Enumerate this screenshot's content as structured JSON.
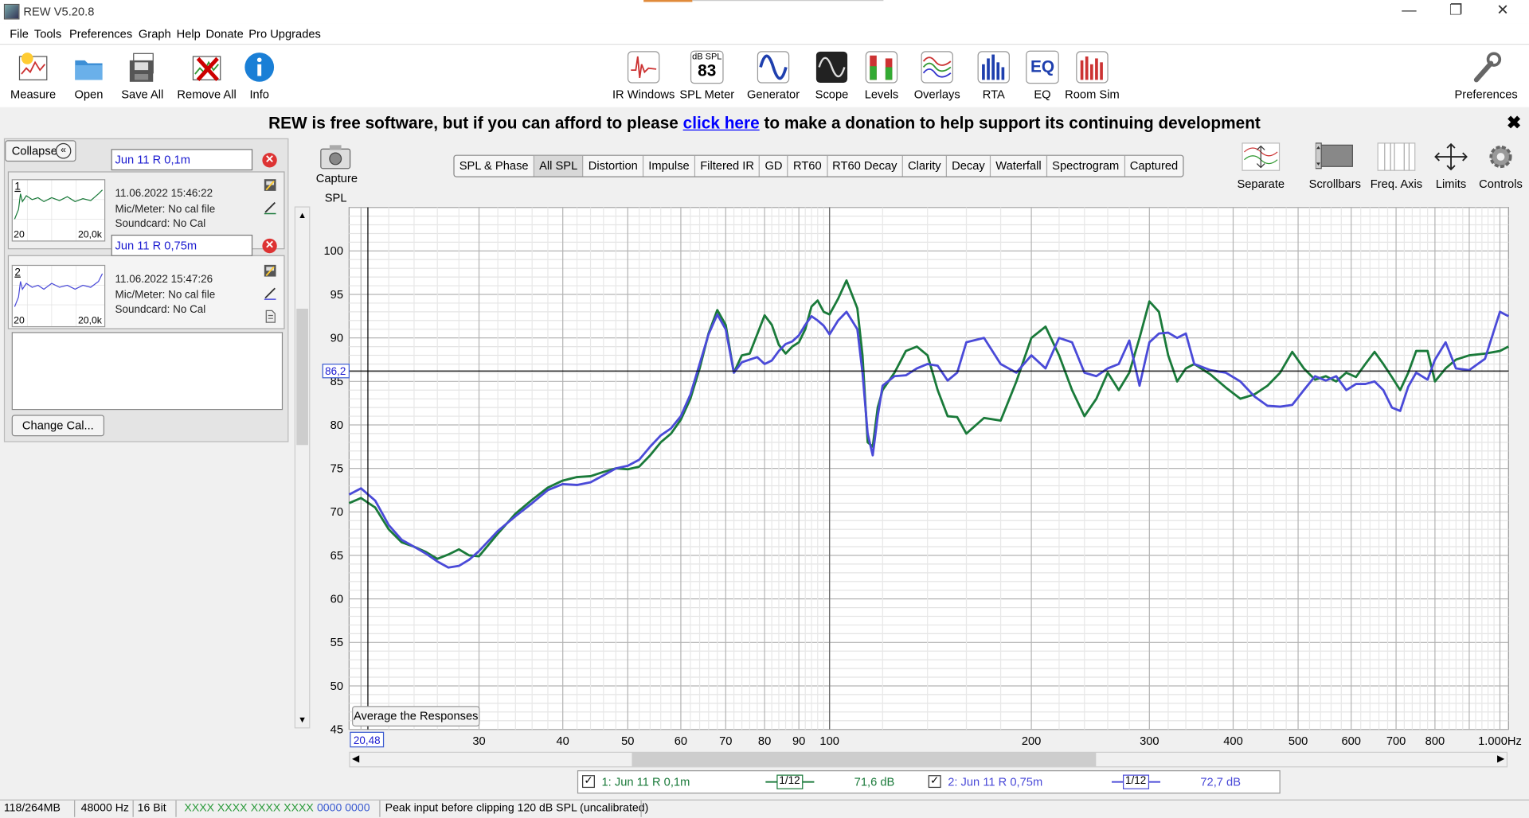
{
  "window": {
    "title": "REW V5.20.8",
    "minimize": "—",
    "restore": "❐",
    "close": "✕"
  },
  "menu": [
    "File",
    "Tools",
    "Preferences",
    "Graph",
    "Help",
    "Donate",
    "Pro Upgrades"
  ],
  "toolbar_left": [
    "Measure",
    "Open",
    "Save All",
    "Remove All",
    "Info"
  ],
  "toolbar_mid": [
    "IR Windows",
    "SPL Meter",
    "Generator",
    "Scope",
    "Levels",
    "Overlays",
    "RTA",
    "EQ",
    "Room Sim"
  ],
  "spl_meter_icon": {
    "top": "dB SPL",
    "value": "83"
  },
  "toolbar_right": "Preferences",
  "banner": {
    "pre": "REW is free software, but if you can afford to please ",
    "link": "click here",
    "post": " to make a donation to help support its continuing development",
    "close": "✖"
  },
  "panel": {
    "collapse": "Collapse",
    "measurements": [
      {
        "index": "1",
        "name": "Jun 11 R 0,1m",
        "date": "11.06.2022 15:46:22",
        "mic": "Mic/Meter: No cal file",
        "soundcard": "Soundcard: No Cal",
        "thumb_min": "20",
        "thumb_max": "20,0k",
        "color": "#1a7a3a"
      },
      {
        "index": "2",
        "name": "Jun 11 R 0,75m",
        "date": "11.06.2022 15:47:26",
        "mic": "Mic/Meter: No cal file",
        "soundcard": "Soundcard: No Cal",
        "thumb_min": "20",
        "thumb_max": "20,0k",
        "color": "#4a4ad8"
      }
    ],
    "change_cal": "Change Cal..."
  },
  "capture": "Capture",
  "tabs": [
    {
      "label": "SPL & Phase",
      "active": false
    },
    {
      "label": "All SPL",
      "active": true
    },
    {
      "label": "Distortion",
      "active": false
    },
    {
      "label": "Impulse",
      "active": false
    },
    {
      "label": "Filtered IR",
      "active": false
    },
    {
      "label": "GD",
      "active": false
    },
    {
      "label": "RT60",
      "active": false
    },
    {
      "label": "RT60 Decay",
      "active": false
    },
    {
      "label": "Clarity",
      "active": false
    },
    {
      "label": "Decay",
      "active": false
    },
    {
      "label": "Waterfall",
      "active": false
    },
    {
      "label": "Spectrogram",
      "active": false
    },
    {
      "label": "Captured",
      "active": false
    }
  ],
  "right_tools": [
    "Separate",
    "Scrollbars",
    "Freq. Axis",
    "Limits",
    "Controls"
  ],
  "average_btn": "Average the Responses",
  "legend": [
    {
      "label": "1: Jun 11 R 0,1m",
      "smoothing": "1/12",
      "level": "71,6 dB",
      "color": "#1a7a3a"
    },
    {
      "label": "2: Jun 11 R 0,75m",
      "smoothing": "1/12",
      "level": "72,7 dB",
      "color": "#4a4ad8"
    }
  ],
  "status": {
    "memory": "118/264MB",
    "rate": "48000 Hz",
    "bits": "16 Bit",
    "g1": "XXXX XXXX",
    "g2": "XXXX XXXX",
    "b1": "0000 0000",
    "peak": "Peak input before clipping 120 dB SPL (uncalibrated)"
  },
  "chart_data": {
    "type": "line",
    "ylabel": "SPL",
    "xunit": "Hz",
    "xscale": "log",
    "xlim": [
      19.2,
      1030
    ],
    "ylim": [
      45,
      105
    ],
    "yticks": [
      45,
      50,
      55,
      60,
      65,
      70,
      75,
      80,
      85,
      90,
      95,
      100
    ],
    "xticks": [
      {
        "value": 30,
        "label": "30"
      },
      {
        "value": 40,
        "label": "40"
      },
      {
        "value": 50,
        "label": "50"
      },
      {
        "value": 60,
        "label": "60"
      },
      {
        "value": 70,
        "label": "70"
      },
      {
        "value": 80,
        "label": "80"
      },
      {
        "value": 90,
        "label": "90"
      },
      {
        "value": 100,
        "label": "100"
      },
      {
        "value": 200,
        "label": "200"
      },
      {
        "value": 300,
        "label": "300"
      },
      {
        "value": 400,
        "label": "400"
      },
      {
        "value": 500,
        "label": "500"
      },
      {
        "value": 600,
        "label": "600"
      },
      {
        "value": 700,
        "label": "700"
      },
      {
        "value": 800,
        "label": "800"
      },
      {
        "value": 1000,
        "label": "1.000Hz"
      }
    ],
    "cursor": {
      "x": 20.48,
      "y": 86.2,
      "x_label": "20,48",
      "y_label": "86,2"
    },
    "grid": true,
    "series": [
      {
        "name": "1: Jun 11 R 0,1m",
        "color": "#1a7a3a",
        "x": [
          19.2,
          20,
          21,
          22,
          23,
          24,
          25,
          26,
          27,
          28,
          29,
          30,
          32,
          34,
          36,
          38,
          40,
          42,
          44,
          46,
          48,
          50,
          52,
          54,
          56,
          58,
          60,
          62,
          64,
          66,
          68,
          70,
          72,
          74,
          76,
          78,
          80,
          82,
          84,
          86,
          88,
          90,
          92,
          94,
          96,
          98,
          100,
          103,
          106,
          110,
          112,
          114,
          116,
          118,
          120,
          125,
          130,
          135,
          140,
          145,
          150,
          155,
          160,
          170,
          180,
          190,
          200,
          210,
          220,
          230,
          240,
          250,
          260,
          270,
          280,
          290,
          300,
          310,
          320,
          330,
          340,
          350,
          370,
          390,
          410,
          430,
          450,
          470,
          490,
          510,
          530,
          550,
          570,
          590,
          610,
          630,
          650,
          670,
          690,
          710,
          730,
          750,
          780,
          800,
          830,
          860,
          900,
          950,
          1000,
          1030
        ],
        "y": [
          71,
          71.6,
          70.5,
          68,
          66.5,
          66,
          65.4,
          64.6,
          65.1,
          65.7,
          65,
          64.9,
          67.5,
          69.8,
          71.4,
          72.8,
          73.6,
          74,
          74.1,
          74.6,
          75,
          74.9,
          75.2,
          76.5,
          78,
          79,
          80.6,
          83,
          86.5,
          90.5,
          93.2,
          91.5,
          86,
          88,
          88.2,
          90.4,
          92.6,
          91.5,
          89.2,
          88.2,
          89,
          89.5,
          91,
          93.6,
          94.3,
          93,
          92.7,
          94.5,
          96.6,
          93.4,
          88,
          78,
          77.5,
          82,
          84,
          86,
          88.5,
          89,
          88,
          84,
          81,
          80.9,
          79,
          80.8,
          80.5,
          85,
          90,
          91.3,
          88,
          84,
          81,
          83,
          86,
          84,
          86,
          90,
          94.2,
          93,
          88,
          85,
          86.5,
          87,
          85.8,
          84.3,
          83,
          83.5,
          84.5,
          86,
          88.4,
          86.5,
          85.2,
          85.6,
          85,
          86,
          85.5,
          87,
          88.4,
          87,
          85.5,
          84,
          86,
          88.5,
          88.5,
          85,
          86.5,
          87.5,
          88,
          88.2,
          88.5,
          89
        ]
      },
      {
        "name": "2: Jun 11 R 0,75m",
        "color": "#4a4ad8",
        "x": [
          19.2,
          20,
          21,
          22,
          23,
          24,
          25,
          26,
          27,
          28,
          29,
          30,
          32,
          34,
          36,
          38,
          40,
          42,
          44,
          46,
          48,
          50,
          52,
          54,
          56,
          58,
          60,
          62,
          64,
          66,
          68,
          70,
          72,
          74,
          76,
          78,
          80,
          82,
          84,
          86,
          88,
          90,
          92,
          94,
          96,
          98,
          100,
          103,
          106,
          110,
          112,
          114,
          116,
          118,
          120,
          125,
          130,
          135,
          140,
          145,
          150,
          155,
          160,
          170,
          180,
          190,
          200,
          210,
          220,
          230,
          240,
          250,
          260,
          270,
          280,
          290,
          300,
          310,
          320,
          330,
          340,
          350,
          370,
          390,
          410,
          430,
          450,
          470,
          490,
          510,
          530,
          550,
          570,
          590,
          610,
          630,
          650,
          670,
          690,
          710,
          730,
          750,
          780,
          800,
          830,
          860,
          900,
          950,
          1000,
          1030
        ],
        "y": [
          72,
          72.7,
          71.3,
          68.5,
          66.8,
          66,
          65.2,
          64.3,
          63.6,
          63.8,
          64.5,
          65.5,
          67.8,
          69.5,
          71,
          72.5,
          73.2,
          73.1,
          73.4,
          74.2,
          75,
          75.3,
          76,
          77.5,
          78.8,
          79.6,
          81,
          83.5,
          87,
          90.4,
          92.7,
          91,
          86,
          87.2,
          87.5,
          87.8,
          87,
          87.4,
          88.5,
          89.3,
          89.6,
          90.3,
          91.5,
          92.5,
          92,
          91.4,
          90.4,
          92,
          93,
          91,
          86,
          79,
          76.5,
          81,
          84.5,
          85.6,
          85.7,
          86.5,
          87,
          86.8,
          85.1,
          86,
          89.5,
          90,
          87,
          86,
          88,
          86.5,
          90,
          89.5,
          86,
          85.6,
          86.5,
          87,
          89.7,
          84.5,
          89.5,
          90.5,
          90.6,
          90,
          90.5,
          87,
          86.3,
          86,
          85,
          83.3,
          82.2,
          82.1,
          82.3,
          84,
          85.6,
          85.1,
          85.6,
          84,
          84.7,
          84.7,
          85,
          84,
          82,
          81.6,
          84.4,
          86,
          85.2,
          87.5,
          89.5,
          86.5,
          86.3,
          87.6,
          93,
          92.5
        ]
      }
    ]
  }
}
